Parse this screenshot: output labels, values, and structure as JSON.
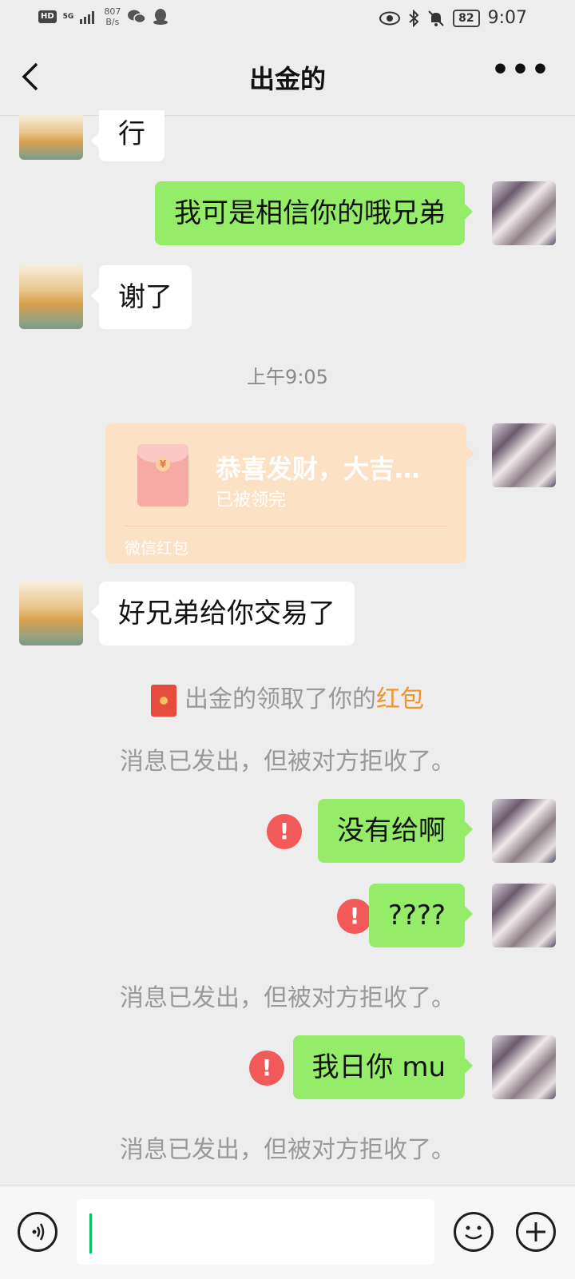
{
  "status_bar": {
    "hd": "HD",
    "network": "5G",
    "speed_value": "807",
    "speed_unit": "B/s",
    "battery": "82",
    "time": "9:07"
  },
  "header": {
    "title": "出金的",
    "more": "•••"
  },
  "messages": [
    {
      "side": "left",
      "text": "行"
    },
    {
      "side": "right",
      "text": "我可是相信你的哦兄弟"
    },
    {
      "side": "left",
      "text": "谢了"
    },
    {
      "type": "timestamp",
      "text": "上午9:05"
    },
    {
      "side": "right",
      "type": "red_packet",
      "title": "恭喜发财，大吉…",
      "status": "已被领完",
      "footer": "微信红包"
    },
    {
      "side": "left",
      "text": "好兄弟给你交易了"
    },
    {
      "type": "system",
      "prefix": "出金的领取了你的",
      "highlight": "红包"
    },
    {
      "type": "system",
      "text": "消息已发出，但被对方拒收了。"
    },
    {
      "side": "right",
      "text": "没有给啊",
      "failed": true
    },
    {
      "side": "right",
      "text": "????",
      "failed": true
    },
    {
      "type": "system",
      "text": "消息已发出，但被对方拒收了。"
    },
    {
      "side": "right",
      "text": "我日你 mu",
      "failed": true
    },
    {
      "type": "system",
      "text": "消息已发出，但被对方拒收了。"
    }
  ],
  "error_mark": "!",
  "colors": {
    "sent_bubble": "#95ec69",
    "received_bubble": "#ffffff",
    "red_packet": "#fce1c5",
    "error": "#f25a5a",
    "highlight": "#f0932b",
    "cursor": "#07c160"
  },
  "input_bar": {
    "voice_icon": "voice-icon",
    "emoji_icon": "emoji-icon",
    "plus_icon": "plus-icon",
    "value": ""
  }
}
